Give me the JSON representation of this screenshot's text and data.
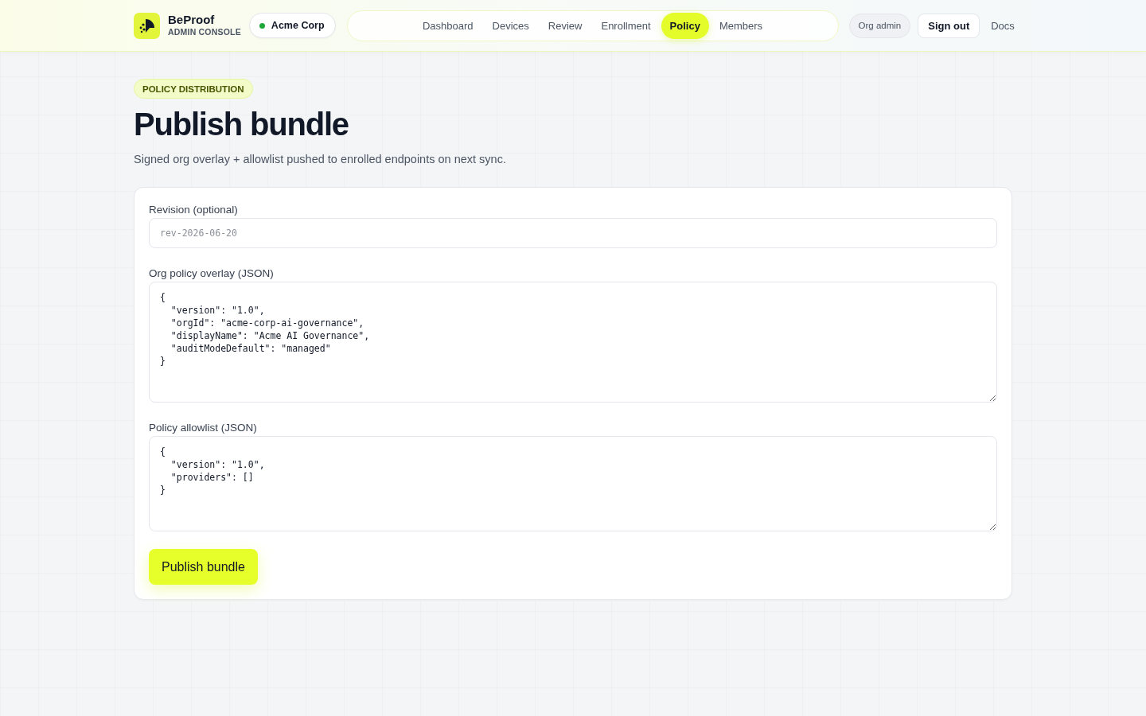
{
  "brand": {
    "name": "BeProof",
    "subtitle": "ADMIN CONSOLE"
  },
  "org_switcher": {
    "label": "Acme Corp"
  },
  "nav": [
    {
      "label": "Dashboard",
      "selected": false
    },
    {
      "label": "Devices",
      "selected": false
    },
    {
      "label": "Review",
      "selected": false
    },
    {
      "label": "Enrollment",
      "selected": false
    },
    {
      "label": "Policy",
      "selected": true
    },
    {
      "label": "Members",
      "selected": false
    }
  ],
  "role_badge": "Org admin",
  "sign_out": "Sign out",
  "docs_link": "Docs",
  "page": {
    "eyebrow": "POLICY DISTRIBUTION",
    "title": "Publish bundle",
    "subtitle": "Signed org overlay + allowlist pushed to enrolled endpoints on next sync."
  },
  "form": {
    "fields": [
      {
        "kind": "input",
        "label": "Revision (optional)",
        "placeholder": "rev-2026-06-20"
      },
      {
        "kind": "textarea",
        "label": "Org policy overlay (JSON)",
        "value": "{\n  \"version\": \"1.0\",\n  \"orgId\": \"acme-corp-ai-governance\",\n  \"displayName\": \"Acme AI Governance\",\n  \"auditModeDefault\": \"managed\"\n}"
      },
      {
        "kind": "textarea",
        "label": "Policy allowlist (JSON)",
        "value": "{\n  \"version\": \"1.0\",\n  \"providers\": []\n}"
      }
    ],
    "submit": "Publish bundle"
  }
}
